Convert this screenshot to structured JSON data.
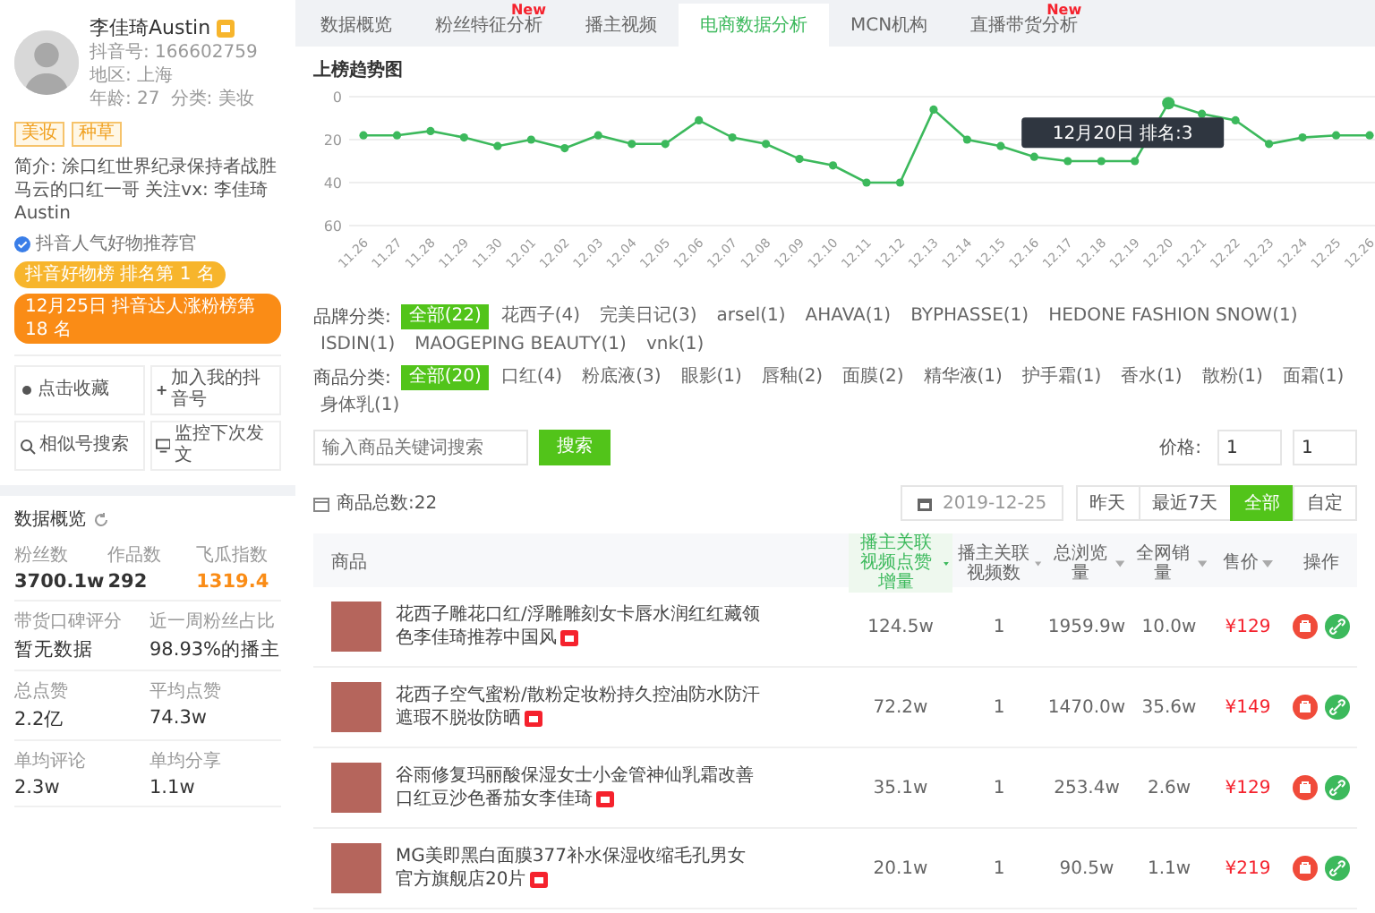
{
  "profile": {
    "name": "李佳琦Austin",
    "account": "抖音号: 166602759",
    "region": "地区: 上海",
    "age": "年龄: 27",
    "category": "分类: 美妆",
    "tags": [
      "美妆",
      "种草"
    ],
    "intro": "简介: 涂口红世界纪录保持者战胜马云的口红一哥 关注vx: 李佳琦Austin",
    "verified": "抖音人气好物推荐官",
    "ranks": [
      {
        "text": "抖音好物榜 排名第 1 名",
        "color": "#f7b52c"
      },
      {
        "text": "12月25日 抖音达人涨粉榜第 18 名",
        "color": "#fa8c16"
      }
    ],
    "actions": [
      {
        "label": "点击收藏",
        "kind": "star"
      },
      {
        "label": "加入我的抖音号",
        "kind": "add"
      },
      {
        "label": "相似号搜索",
        "kind": "search"
      },
      {
        "label": "监控下次发文",
        "kind": "monitor"
      }
    ]
  },
  "overview": {
    "title": "数据概览",
    "rows": [
      [
        {
          "label": "粉丝数",
          "value": "3700.1w",
          "highlight": false
        },
        {
          "label": "作品数",
          "value": "292",
          "highlight": false
        },
        {
          "label": "飞瓜指数",
          "value": "1319.4",
          "highlight": true
        }
      ],
      [
        {
          "label": "带货口碑评分",
          "value": "暂无数据",
          "highlight": false
        },
        {
          "label": "近一周粉丝占比",
          "value": "98.93%的播主",
          "highlight": false
        }
      ],
      [
        {
          "label": "总点赞",
          "value": "2.2亿",
          "highlight": false
        },
        {
          "label": "平均点赞",
          "value": "74.3w",
          "highlight": false
        }
      ],
      [
        {
          "label": "单均评论",
          "value": "2.3w",
          "highlight": false
        },
        {
          "label": "单均分享",
          "value": "1.1w",
          "highlight": false
        }
      ]
    ]
  },
  "tabs": [
    {
      "label": "数据概览",
      "selected": false
    },
    {
      "label": "粉丝特征分析",
      "selected": false,
      "badge": "New"
    },
    {
      "label": "播主视频",
      "selected": false
    },
    {
      "label": "电商数据分析",
      "selected": true
    },
    {
      "label": "MCN机构",
      "selected": false
    },
    {
      "label": "直播带货分析",
      "selected": false,
      "badge": "New"
    }
  ],
  "chart": {
    "chart_data": {
      "type": "line",
      "title": "上榜趋势图",
      "categories": [
        "11.26",
        "11.27",
        "11.28",
        "11.29",
        "11.30",
        "12.01",
        "12.02",
        "12.03",
        "12.04",
        "12.05",
        "12.06",
        "12.07",
        "12.08",
        "12.09",
        "12.10",
        "12.11",
        "12.12",
        "12.13",
        "12.14",
        "12.15",
        "12.16",
        "12.17",
        "12.18",
        "12.19",
        "12.20",
        "12.21",
        "12.22",
        "12.23",
        "12.24",
        "12.25",
        "12.26"
      ],
      "series": [
        {
          "color": "#3cb95c",
          "marker": "circle",
          "values": [
            18,
            18,
            16,
            19,
            23,
            20,
            24,
            18,
            22,
            22,
            11,
            19,
            22,
            29,
            32,
            40,
            40,
            6,
            20,
            23,
            28,
            30,
            30,
            30,
            3,
            8,
            11,
            22,
            19,
            18,
            18
          ]
        }
      ],
      "ylim": [
        60,
        0
      ],
      "yticks": [
        0,
        20,
        40,
        60
      ],
      "annotations": [
        {
          "x": "12.20",
          "y": 3,
          "text": "12月20日 排名:3"
        }
      ]
    }
  },
  "filters": {
    "brand": {
      "label": "品牌分类:",
      "options": [
        {
          "label": "全部(22)",
          "selected": true
        },
        {
          "label": "花西子(4)",
          "selected": false
        },
        {
          "label": "完美日记(3)",
          "selected": false
        },
        {
          "label": "arsel(1)",
          "selected": false
        },
        {
          "label": "AHAVA(1)",
          "selected": false
        },
        {
          "label": "BYPHASSE(1)",
          "selected": false
        },
        {
          "label": "HEDONE FASHION SNOW(1)",
          "selected": false
        },
        {
          "label": "ISDIN(1)",
          "selected": false
        },
        {
          "label": "MAOGEPING BEAUTY(1)",
          "selected": false
        },
        {
          "label": "vnk(1)",
          "selected": false
        }
      ]
    },
    "category": {
      "label": "商品分类:",
      "options": [
        {
          "label": "全部(20)",
          "selected": true
        },
        {
          "label": "口红(4)",
          "selected": false
        },
        {
          "label": "粉底液(3)",
          "selected": false
        },
        {
          "label": "眼影(1)",
          "selected": false
        },
        {
          "label": "唇釉(2)",
          "selected": false
        },
        {
          "label": "面膜(2)",
          "selected": false
        },
        {
          "label": "精华液(1)",
          "selected": false
        },
        {
          "label": "护手霜(1)",
          "selected": false
        },
        {
          "label": "香水(1)",
          "selected": false
        },
        {
          "label": "散粉(1)",
          "selected": false
        },
        {
          "label": "面霜(1)",
          "selected": false
        },
        {
          "label": "身体乳(1)",
          "selected": false
        }
      ]
    },
    "search": {
      "placeholder": "输入商品关键词搜索",
      "button": "搜索"
    },
    "price": {
      "label": "价格:",
      "min": "1",
      "max": "1"
    }
  },
  "toolbar": {
    "count": "商品总数:22",
    "date": "2019-12-25",
    "ranges": [
      {
        "label": "昨天",
        "selected": false
      },
      {
        "label": "最近7天",
        "selected": false
      },
      {
        "label": "全部",
        "selected": true
      },
      {
        "label": "自定",
        "selected": false
      }
    ]
  },
  "table": {
    "columns": [
      {
        "label": "商品",
        "sortable": false,
        "selected": false
      },
      {
        "label": "播主关联视频点赞增量",
        "sortable": true,
        "selected": true
      },
      {
        "label": "播主关联视频数",
        "sortable": true,
        "selected": false
      },
      {
        "label": "总浏览量",
        "sortable": true,
        "selected": false
      },
      {
        "label": "全网销量",
        "sortable": true,
        "selected": false
      },
      {
        "label": "售价",
        "sortable": true,
        "selected": false
      },
      {
        "label": "操作",
        "sortable": false,
        "selected": false
      }
    ],
    "rows": [
      {
        "cells": [
          "花西子雕花口红/浮雕雕刻女卡唇水润红红藏领色李佳琦推荐中国风",
          "124.5w",
          "1",
          "1959.9w",
          "10.0w",
          "¥129"
        ]
      },
      {
        "cells": [
          "花西子空气蜜粉/散粉定妆粉持久控油防水防汗遮瑕不脱妆防晒",
          "72.2w",
          "1",
          "1470.0w",
          "35.6w",
          "¥149"
        ]
      },
      {
        "cells": [
          "谷雨修复玛丽酸保湿女士小金管神仙乳霜改善口红豆沙色番茄女李佳琦",
          "35.1w",
          "1",
          "253.4w",
          "2.6w",
          "¥129"
        ]
      },
      {
        "cells": [
          "MG美即黑白面膜377补水保湿收缩毛孔男女官方旗舰店20片",
          "20.1w",
          "1",
          "90.5w",
          "1.1w",
          "¥219"
        ]
      }
    ]
  }
}
